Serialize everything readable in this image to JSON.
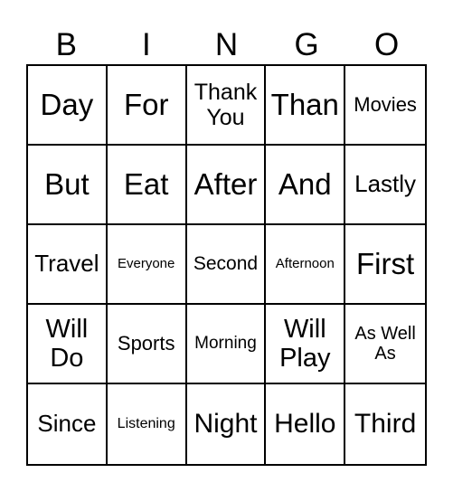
{
  "header": {
    "letters": [
      "B",
      "I",
      "N",
      "G",
      "O"
    ]
  },
  "card": {
    "rows": [
      [
        {
          "text": "Day",
          "size": 33
        },
        {
          "text": "For",
          "size": 33
        },
        {
          "text": "Thank You",
          "lines": [
            "Thank",
            "You"
          ],
          "size": 25
        },
        {
          "text": "Than",
          "size": 33
        },
        {
          "text": "Movies",
          "size": 22
        }
      ],
      [
        {
          "text": "But",
          "size": 33
        },
        {
          "text": "Eat",
          "size": 33
        },
        {
          "text": "After",
          "size": 33
        },
        {
          "text": "And",
          "size": 33
        },
        {
          "text": "Lastly",
          "size": 26
        }
      ],
      [
        {
          "text": "Travel",
          "size": 26
        },
        {
          "text": "Everyone",
          "size": 15
        },
        {
          "text": "Second",
          "size": 21
        },
        {
          "text": "Afternoon",
          "size": 15
        },
        {
          "text": "First",
          "size": 33
        }
      ],
      [
        {
          "text": "Will Do",
          "lines": [
            "Will",
            "Do"
          ],
          "size": 29
        },
        {
          "text": "Sports",
          "size": 22
        },
        {
          "text": "Morning",
          "size": 19
        },
        {
          "text": "Will Play",
          "lines": [
            "Will",
            "Play"
          ],
          "size": 29
        },
        {
          "text": "As Well As",
          "lines": [
            "As Well",
            "As"
          ],
          "size": 20
        }
      ],
      [
        {
          "text": "Since",
          "size": 26
        },
        {
          "text": "Listening",
          "size": 16
        },
        {
          "text": "Night",
          "size": 30
        },
        {
          "text": "Hello",
          "size": 30
        },
        {
          "text": "Third",
          "size": 30
        }
      ]
    ]
  }
}
